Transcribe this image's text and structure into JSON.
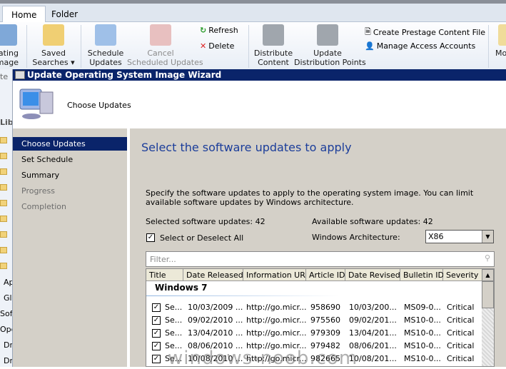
{
  "ribbon": {
    "tabs": [
      "Home",
      "Folder"
    ],
    "buttons": {
      "partial_left": "ating\nmage",
      "saved_searches": "Saved\nSearches ▾",
      "schedule_updates": "Schedule\nUpdates",
      "cancel_scheduled": "Cancel\nScheduled Updates",
      "refresh": "Refresh",
      "delete": "Delete",
      "distribute_content": "Distribute\nContent",
      "update_dps": "Update\nDistribution Points",
      "create_prestage": "Create Prestage Content File",
      "manage_access": "Manage Access Accounts",
      "partial_right": "Mo"
    }
  },
  "leftpane": {
    "partial": [
      "te",
      "Lib",
      "Ap",
      "Gl",
      "Soft",
      "Ope",
      "Dr",
      "Dr"
    ]
  },
  "wizard": {
    "title": "Update Operating System Image Wizard",
    "header_title": "Choose Updates",
    "nav": [
      {
        "label": "Choose Updates",
        "state": "active"
      },
      {
        "label": "Set Schedule",
        "state": "normal"
      },
      {
        "label": "Summary",
        "state": "normal"
      },
      {
        "label": "Progress",
        "state": "disabled"
      },
      {
        "label": "Completion",
        "state": "disabled"
      }
    ],
    "heading": "Select the software updates to apply",
    "description": "Specify the software updates to apply to the operating system image. You can limit available software updates by Windows architecture.",
    "selected_label": "Selected software updates: 42",
    "available_label": "Available software updates: 42",
    "select_all_label": "Select or Deselect All",
    "select_all_checked": true,
    "arch_label": "Windows Architecture:",
    "arch_value": "X86",
    "filter_placeholder": "Filter...",
    "columns": [
      "Title",
      "Date Released",
      "Information URL",
      "Article ID",
      "Date Revised",
      "Bulletin ID",
      "Severity"
    ],
    "group": "Windows 7",
    "rows": [
      [
        "Se...",
        "10/03/2009 ...",
        "http://go.micr...",
        "958690",
        "10/03/200...",
        "MS09-0...",
        "Critical"
      ],
      [
        "Se...",
        "09/02/2010 ...",
        "http://go.micr...",
        "975560",
        "09/02/201...",
        "MS10-0...",
        "Critical"
      ],
      [
        "Se...",
        "13/04/2010 ...",
        "http://go.micr...",
        "979309",
        "13/04/201...",
        "MS10-0...",
        "Critical"
      ],
      [
        "Se...",
        "08/06/2010 ...",
        "http://go.micr...",
        "979482",
        "08/06/201...",
        "MS10-0...",
        "Critical"
      ],
      [
        "Se...",
        "10/08/2010 ...",
        "http://go.micr...",
        "982665",
        "10/08/201...",
        "MS10-0...",
        "Critical"
      ]
    ]
  },
  "watermark": "windows-noob.com"
}
